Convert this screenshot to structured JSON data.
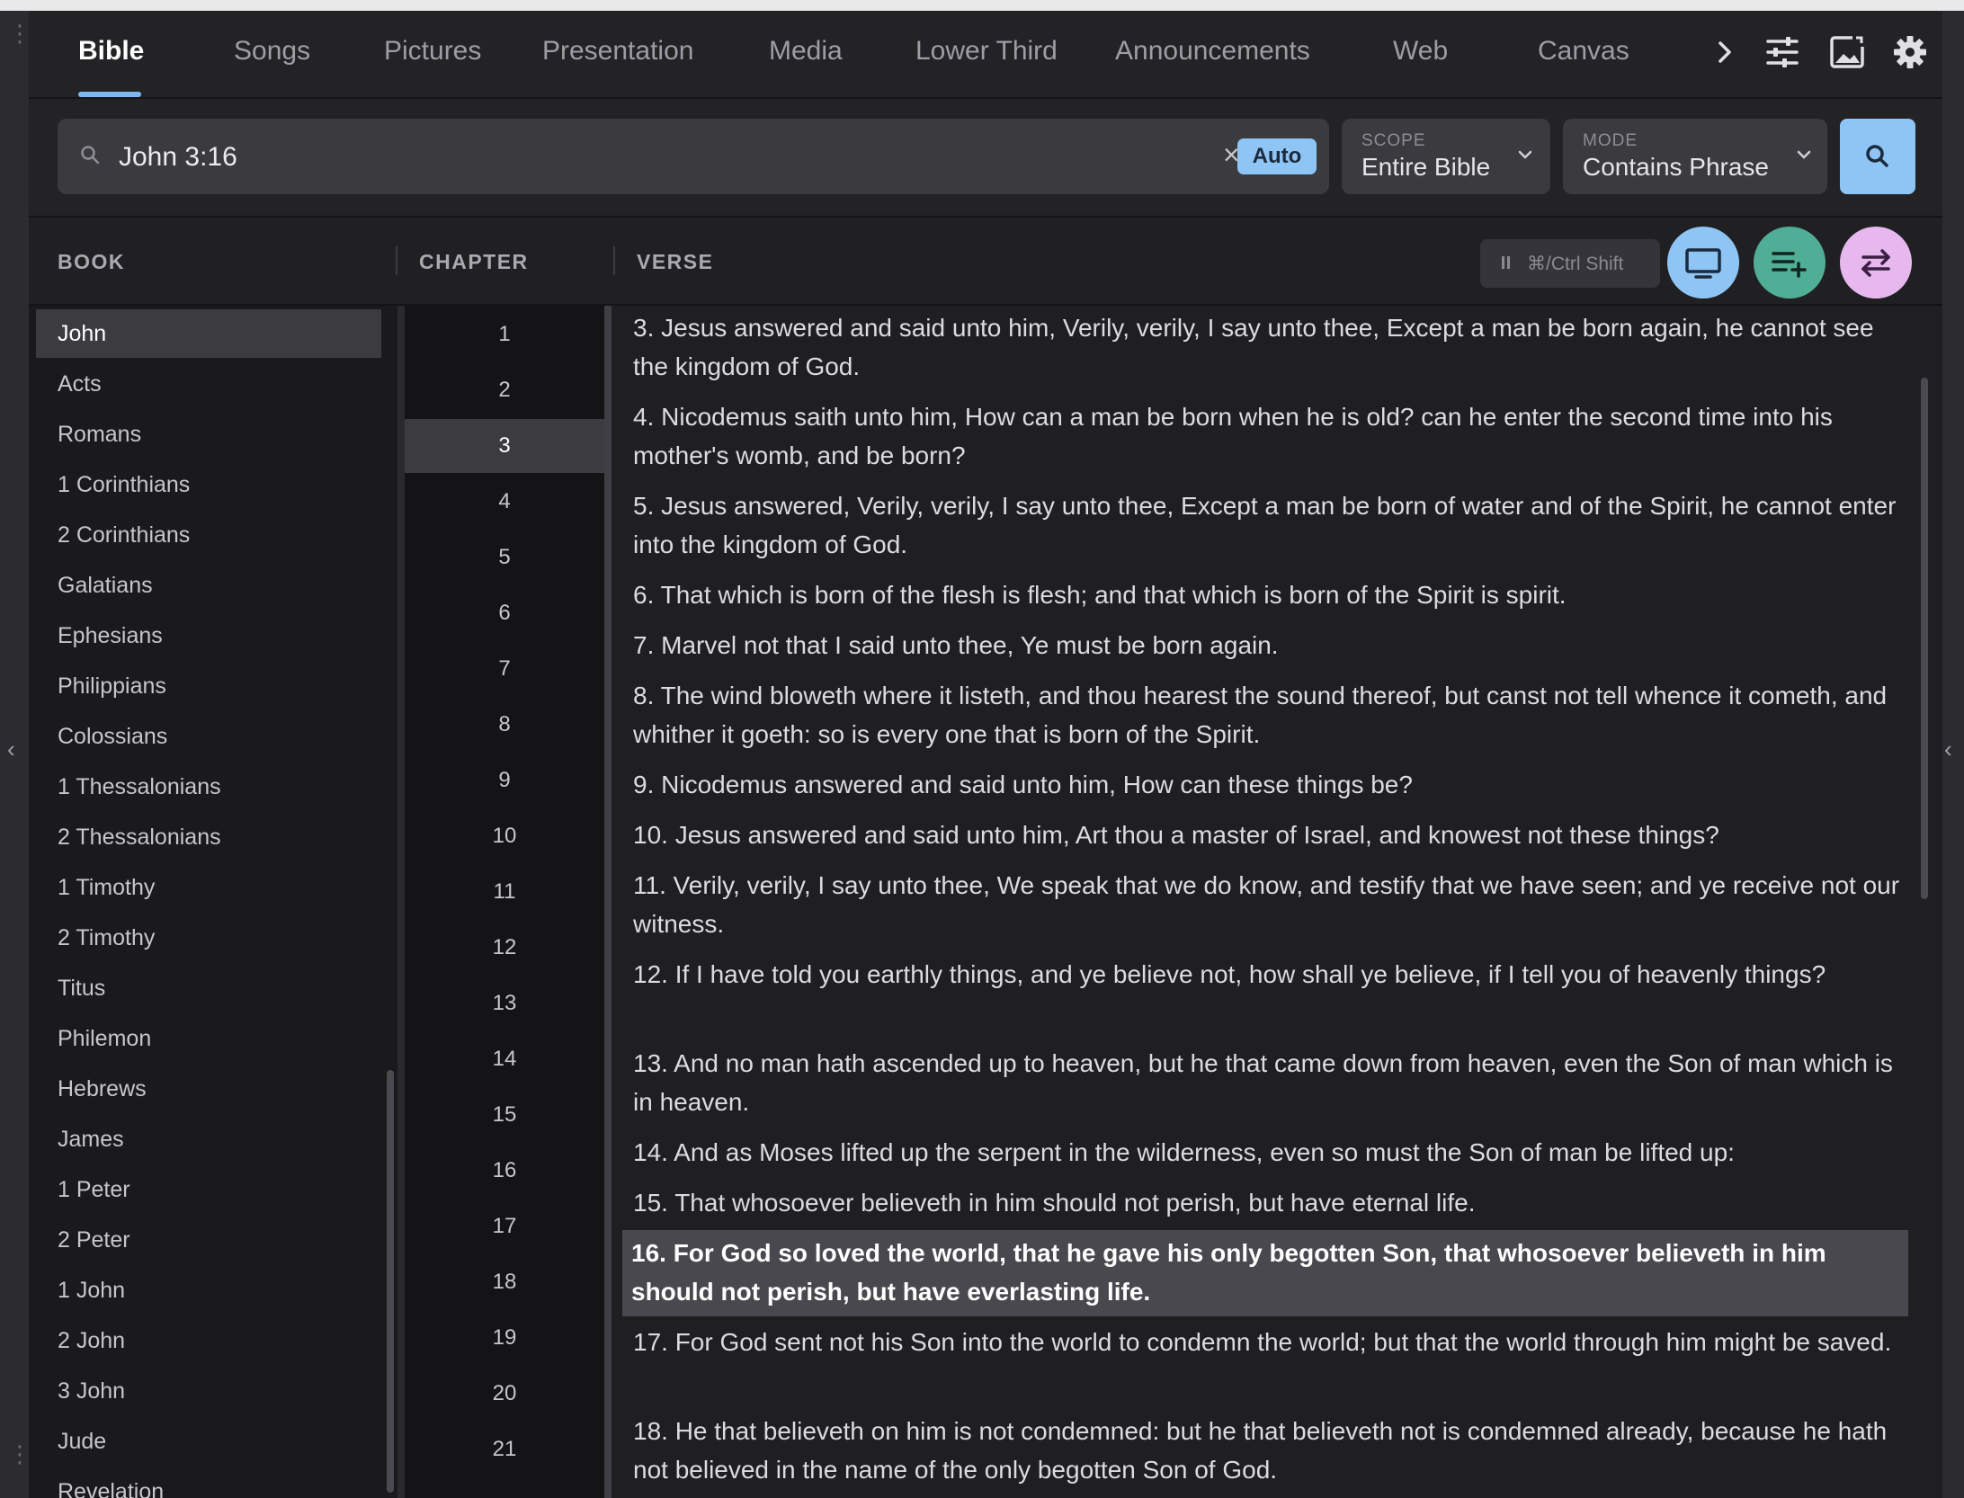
{
  "tabs": [
    "Bible",
    "Songs",
    "Pictures",
    "Presentation",
    "Media",
    "Lower Third",
    "Announcements",
    "Web",
    "Canvas"
  ],
  "toolbar_icons": [
    "chevron-right-icon",
    "sliders-icon",
    "image-display-icon",
    "gear-icon"
  ],
  "search": {
    "query": "John 3:16",
    "auto_label": "Auto",
    "clear_label": "×",
    "scope_label": "SCOPE",
    "scope_value": "Entire Bible",
    "mode_label": "MODE",
    "mode_value": "Contains Phrase"
  },
  "columns": {
    "book": "BOOK",
    "chapter": "CHAPTER",
    "verse": "VERSE",
    "shortcut": "⌘/Ctrl Shift"
  },
  "books": [
    "John",
    "Acts",
    "Romans",
    "1 Corinthians",
    "2 Corinthians",
    "Galatians",
    "Ephesians",
    "Philippians",
    "Colossians",
    "1 Thessalonians",
    "2 Thessalonians",
    "1 Timothy",
    "2 Timothy",
    "Titus",
    "Philemon",
    "Hebrews",
    "James",
    "1 Peter",
    "2 Peter",
    "1 John",
    "2 John",
    "3 John",
    "Jude",
    "Revelation"
  ],
  "selected_book": "John",
  "chapters": [
    "1",
    "2",
    "3",
    "4",
    "5",
    "6",
    "7",
    "8",
    "9",
    "10",
    "11",
    "12",
    "13",
    "14",
    "15",
    "16",
    "17",
    "18",
    "19",
    "20",
    "21"
  ],
  "selected_chapter": "3",
  "verses": [
    "3. Jesus answered and said unto him, Verily, verily, I say unto thee, Except a man be born again, he cannot see the kingdom of God.",
    "4. Nicodemus saith unto him, How can a man be born when he is old? can he enter the second time into his mother's womb, and be born?",
    "5. Jesus answered, Verily, verily, I say unto thee, Except a man be born of water and of the Spirit, he cannot enter into the kingdom of God.",
    "6. That which is born of the flesh is flesh; and that which is born of the Spirit is spirit.",
    "7. Marvel not that I said unto thee, Ye must be born again.",
    "8. The wind bloweth where it listeth, and thou hearest the sound thereof, but canst not tell whence it cometh, and whither it goeth: so is every one that is born of the Spirit.",
    "9. Nicodemus answered and said unto him, How can these things be?",
    "10. Jesus answered and said unto him, Art thou a master of Israel, and knowest not these things?",
    "11. Verily, verily, I say unto thee, We speak that we do know, and testify that we have seen; and ye receive not our witness.",
    "12. If I have told you earthly things, and ye believe not, how shall ye believe, if I tell you of heavenly things?",
    "13. And no man hath ascended up to heaven, but he that came down from heaven, even the Son of man which is in heaven.",
    "14. And as Moses lifted up the serpent in the wilderness, even so must the Son of man be lifted up:",
    "15. That whosoever believeth in him should not perish, but have eternal life.",
    "16. For God so loved the world, that he gave his only begotten Son, that whosoever believeth in him should not perish, but have everlasting life.",
    "17. For God sent not his Son into the world to condemn the world; but that the world through him might be saved.",
    "18. He that believeth on him is not condemned: but he that believeth not is condemned already, because he hath not believed in the name of the only begotten Son of God."
  ],
  "selected_verse_index": 13,
  "colors": {
    "accent": "#8ec5f5",
    "green_button": "#4fae95",
    "pink_button": "#e7b8ee",
    "blue_button": "#8ec5f5"
  }
}
